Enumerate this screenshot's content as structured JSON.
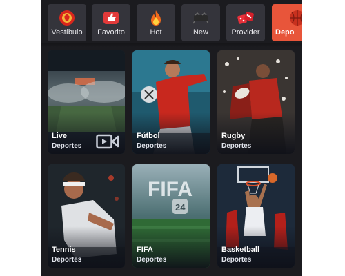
{
  "categories": [
    {
      "label": "Vestíbulo",
      "icon": "lobby-icon",
      "active": false
    },
    {
      "label": "Favorito",
      "icon": "thumbs-up-icon",
      "active": false
    },
    {
      "label": "Hot",
      "icon": "fire-icon",
      "active": false
    },
    {
      "label": "New",
      "icon": "new-icon",
      "active": false
    },
    {
      "label": "Provider",
      "icon": "dice-icon",
      "active": false
    },
    {
      "label": "Depo",
      "icon": "sports-ball-icon",
      "active": true
    }
  ],
  "cards": [
    {
      "title": "Live",
      "subtitle": "Deportes",
      "icon": "video-icon"
    },
    {
      "title": "Fútbol",
      "subtitle": "Deportes"
    },
    {
      "title": "Rugby",
      "subtitle": "Deportes"
    },
    {
      "title": "Tennis",
      "subtitle": "Deportes"
    },
    {
      "title": "FIFA",
      "subtitle": "Deportes",
      "art_text": "FIFA",
      "art_badge": "24"
    },
    {
      "title": "Basketball",
      "subtitle": "Deportes"
    }
  ],
  "colors": {
    "accent": "#e8553a",
    "background": "#1b1b1f",
    "tile": "#34343b"
  }
}
